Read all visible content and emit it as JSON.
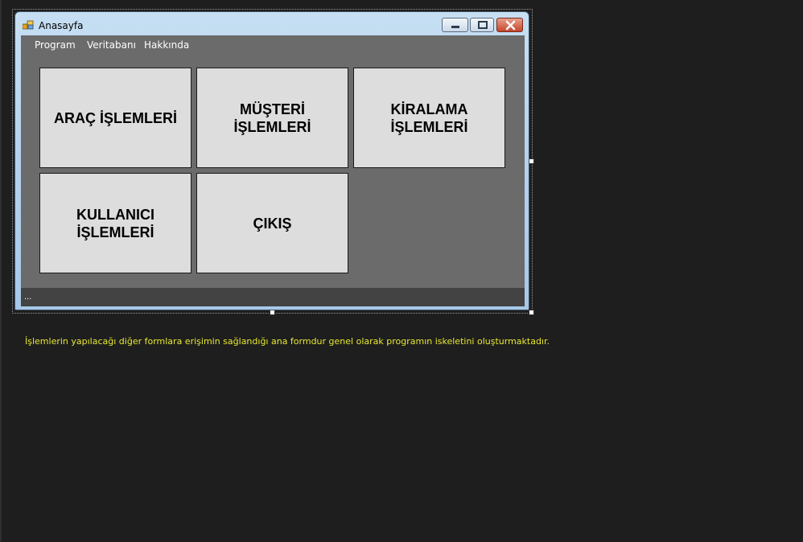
{
  "window": {
    "title": "Anasayfa",
    "controls": [
      "minimize-icon",
      "maximize-icon",
      "close-icon"
    ]
  },
  "menu": {
    "items": [
      "Program",
      "Veritabanı",
      "Hakkında"
    ]
  },
  "tiles": [
    {
      "label": "ARAÇ İŞLEMLERİ"
    },
    {
      "label": "MÜŞTERİ\nİŞLEMLERİ"
    },
    {
      "label": "KİRALAMA\nİŞLEMLERİ"
    },
    {
      "label": "KULLANICI\nİŞLEMLERİ"
    },
    {
      "label": "ÇIKIŞ"
    }
  ],
  "status": {
    "text": "..."
  },
  "description": "İşlemlerin yapılacağı diğer formlara erişimin sağlandığı ana formdur genel olarak programın iskeletini oluşturmaktadır.",
  "colors": {
    "page_background": "#1e1e1e",
    "client_background": "#6b6b6b",
    "tile_background": "#dddddd",
    "statusbar_background": "#434343",
    "description_text": "#e8e832"
  }
}
